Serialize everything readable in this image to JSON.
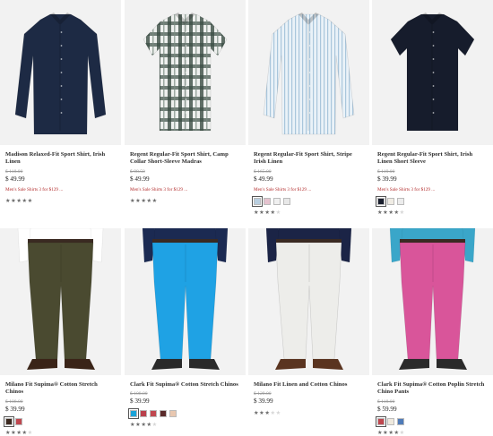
{
  "products": [
    {
      "name": "Madison Relaxed-Fit Sport Shirt, Irish Linen",
      "was_price": "$ 118.00",
      "price": "$ 49.99",
      "promo": "Men's Sale Shirts 3 for $129 ...",
      "swatches": [],
      "rating": 5,
      "image_kind": "shirt-long",
      "colors": {
        "main": "#1d2a44",
        "bg": "#f2f2f2"
      }
    },
    {
      "name": "Regent Regular-Fit Sport Shirt, Camp Collar Short-Sleeve Madras",
      "was_price": "$ 98.50",
      "price": "$ 49.99",
      "promo": "Men's Sale Shirts 3 for $129 ...",
      "swatches": [],
      "rating": 5,
      "image_kind": "shirt-short-plaid",
      "colors": {
        "main": "#e8ecea",
        "bg": "#f2f2f2"
      }
    },
    {
      "name": "Regent Regular-Fit Sport Shirt, Stripe Irish Linen",
      "was_price": "$ 165.00",
      "price": "$ 49.99",
      "promo": "Men's Sale Shirts 3 for $129 ...",
      "swatches": [
        "#b9cfe0",
        "#e6c3cf",
        "#f0f0f0",
        "#e8e8e8"
      ],
      "rating": 4,
      "image_kind": "shirt-long-stripe",
      "colors": {
        "main": "#dbe8f1",
        "bg": "#f2f2f2"
      }
    },
    {
      "name": "Regent Regular-Fit Sport Shirt, Irish Linen Short Sleeve",
      "was_price": "$ 119.00",
      "price": "$ 39.99",
      "promo": "Men's Sale Shirts 3 for $129 ...",
      "swatches": [
        "#1a1f2e",
        "#f0ece4",
        "#ececec"
      ],
      "rating": 4,
      "image_kind": "shirt-short",
      "colors": {
        "main": "#161c2c",
        "bg": "#f2f2f2"
      }
    },
    {
      "name": "Milano Fit Supima® Cotton Stretch Chinos",
      "was_price": "$ 108.00",
      "price": "$ 39.99",
      "promo": "",
      "swatches": [
        "#3c2a20",
        "#c0474f"
      ],
      "rating": 4,
      "image_kind": "pants",
      "colors": {
        "main": "#4a4a30",
        "shirt": "#ffffff",
        "shoe": "#3a2418",
        "bg": "#f2f2f2"
      }
    },
    {
      "name": "Clark Fit Supima® Cotton Stretch Chinos",
      "was_price": "$ 108.00",
      "price": "$ 39.99",
      "promo": "",
      "swatches": [
        "#1aa3d8",
        "#b9404b",
        "#c0474f",
        "#5a2a2a",
        "#e8c7b0"
      ],
      "rating": 4,
      "image_kind": "pants",
      "colors": {
        "main": "#1fa2e4",
        "shirt": "#1b2a52",
        "shoe": "#2a2a2a",
        "bg": "#f2f2f2"
      }
    },
    {
      "name": "Milano Fit Linen and Cotton Chinos",
      "was_price": "$ 129.00",
      "price": "$ 39.99",
      "promo": "",
      "swatches": [],
      "rating": 3,
      "image_kind": "pants",
      "colors": {
        "main": "#ededea",
        "shirt": "#1b2446",
        "shoe": "#5a3420",
        "bg": "#f2f2f2"
      }
    },
    {
      "name": "Clark Fit Supima® Cotton Poplin Stretch Chino Pants",
      "was_price": "$ 118.00",
      "price": "$ 59.99",
      "promo": "",
      "swatches": [
        "#c0474f",
        "#efe9dd",
        "#4f7bb8"
      ],
      "rating": 4,
      "image_kind": "pants",
      "colors": {
        "main": "#d9559a",
        "shirt": "#3aa6c9",
        "shoe": "#2a2a2a",
        "bg": "#f2f2f2"
      }
    }
  ]
}
